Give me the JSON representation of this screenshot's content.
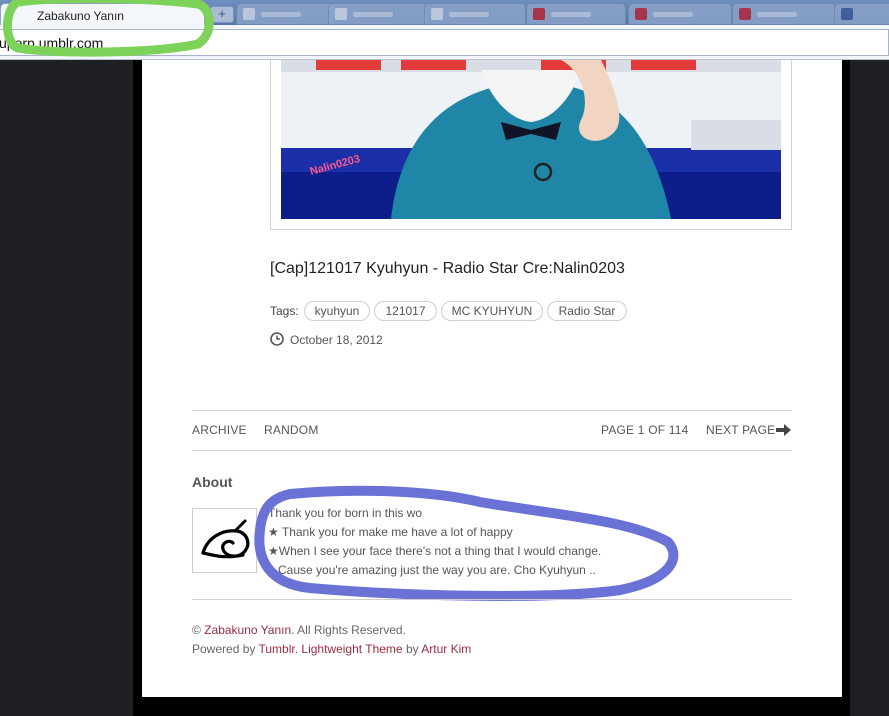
{
  "browser": {
    "active_tab_title": "Zabakuno Yanın",
    "new_tab_symbol": "+",
    "address": "uperp     umblr.com"
  },
  "post": {
    "title": "[Cap]121017 Kyuhyun - Radio Star Cre:Nalin0203",
    "tags_label": "Tags:",
    "tags": [
      "kyuhyun",
      "121017",
      "MC KYUHYUN",
      "Radio Star"
    ],
    "date": "October 18, 2012",
    "photo_watermark": "Nalin0203"
  },
  "pagination": {
    "archive": "ARCHIVE",
    "random": "RANDOM",
    "page_info": "PAGE 1 OF 114",
    "next_page": "NEXT PAGE"
  },
  "about": {
    "heading": "About",
    "lines": [
      "Thank you for born in this wo",
      "★ Thank you for make me have a lot of happy",
      "★When I see your face there's not a thing that I would change.",
      "Cause you're amazing just the way you are. Cho Kyuhyun .."
    ]
  },
  "footer": {
    "copyright_prefix": "©",
    "blog_name": "Zabakuno Yanın",
    "rights": ". All Rights Reserved.",
    "powered_by": "Powered by",
    "tumblr": "Tumblr",
    "theme": "Lightweight Theme",
    "by": "by",
    "author": "Artur Kim"
  },
  "colors": {
    "link": "#9b2c3e",
    "annotation_green": "#7dd35a",
    "annotation_blue": "#6b72d6",
    "sweater": "#1f86a8"
  }
}
